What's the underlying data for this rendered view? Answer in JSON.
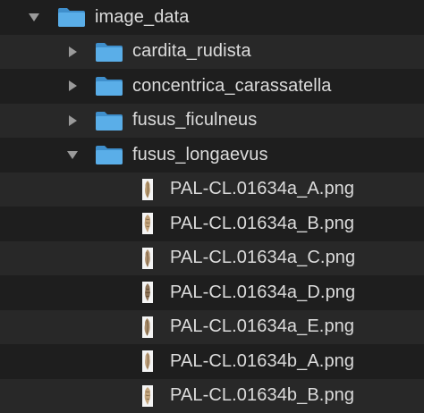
{
  "tree": {
    "root": {
      "name": "image_data",
      "icon": "folder-icon",
      "expanded": true,
      "children": [
        {
          "name": "cardita_rudista",
          "icon": "folder-icon",
          "expanded": false
        },
        {
          "name": "concentrica_carassatella",
          "icon": "folder-icon",
          "expanded": false
        },
        {
          "name": "fusus_ficulneus",
          "icon": "folder-icon",
          "expanded": false
        },
        {
          "name": "fusus_longaevus",
          "icon": "folder-icon",
          "expanded": true,
          "files": [
            {
              "name": "PAL-CL.01634a_A.png",
              "icon": "png-thumbnail-icon"
            },
            {
              "name": "PAL-CL.01634a_B.png",
              "icon": "png-thumbnail-icon"
            },
            {
              "name": "PAL-CL.01634a_C.png",
              "icon": "png-thumbnail-icon"
            },
            {
              "name": "PAL-CL.01634a_D.png",
              "icon": "png-thumbnail-icon"
            },
            {
              "name": "PAL-CL.01634a_E.png",
              "icon": "png-thumbnail-icon"
            },
            {
              "name": "PAL-CL.01634b_A.png",
              "icon": "png-thumbnail-icon"
            },
            {
              "name": "PAL-CL.01634b_B.png",
              "icon": "png-thumbnail-icon"
            }
          ]
        }
      ]
    }
  },
  "colors": {
    "background": "#1e1e1e",
    "row_alt": "#282828",
    "folder_blue": "#5aaee8",
    "folder_blue_dark": "#3f8fcc",
    "disclosure_gray": "#9a9a9a",
    "text": "#dcdcdc"
  }
}
